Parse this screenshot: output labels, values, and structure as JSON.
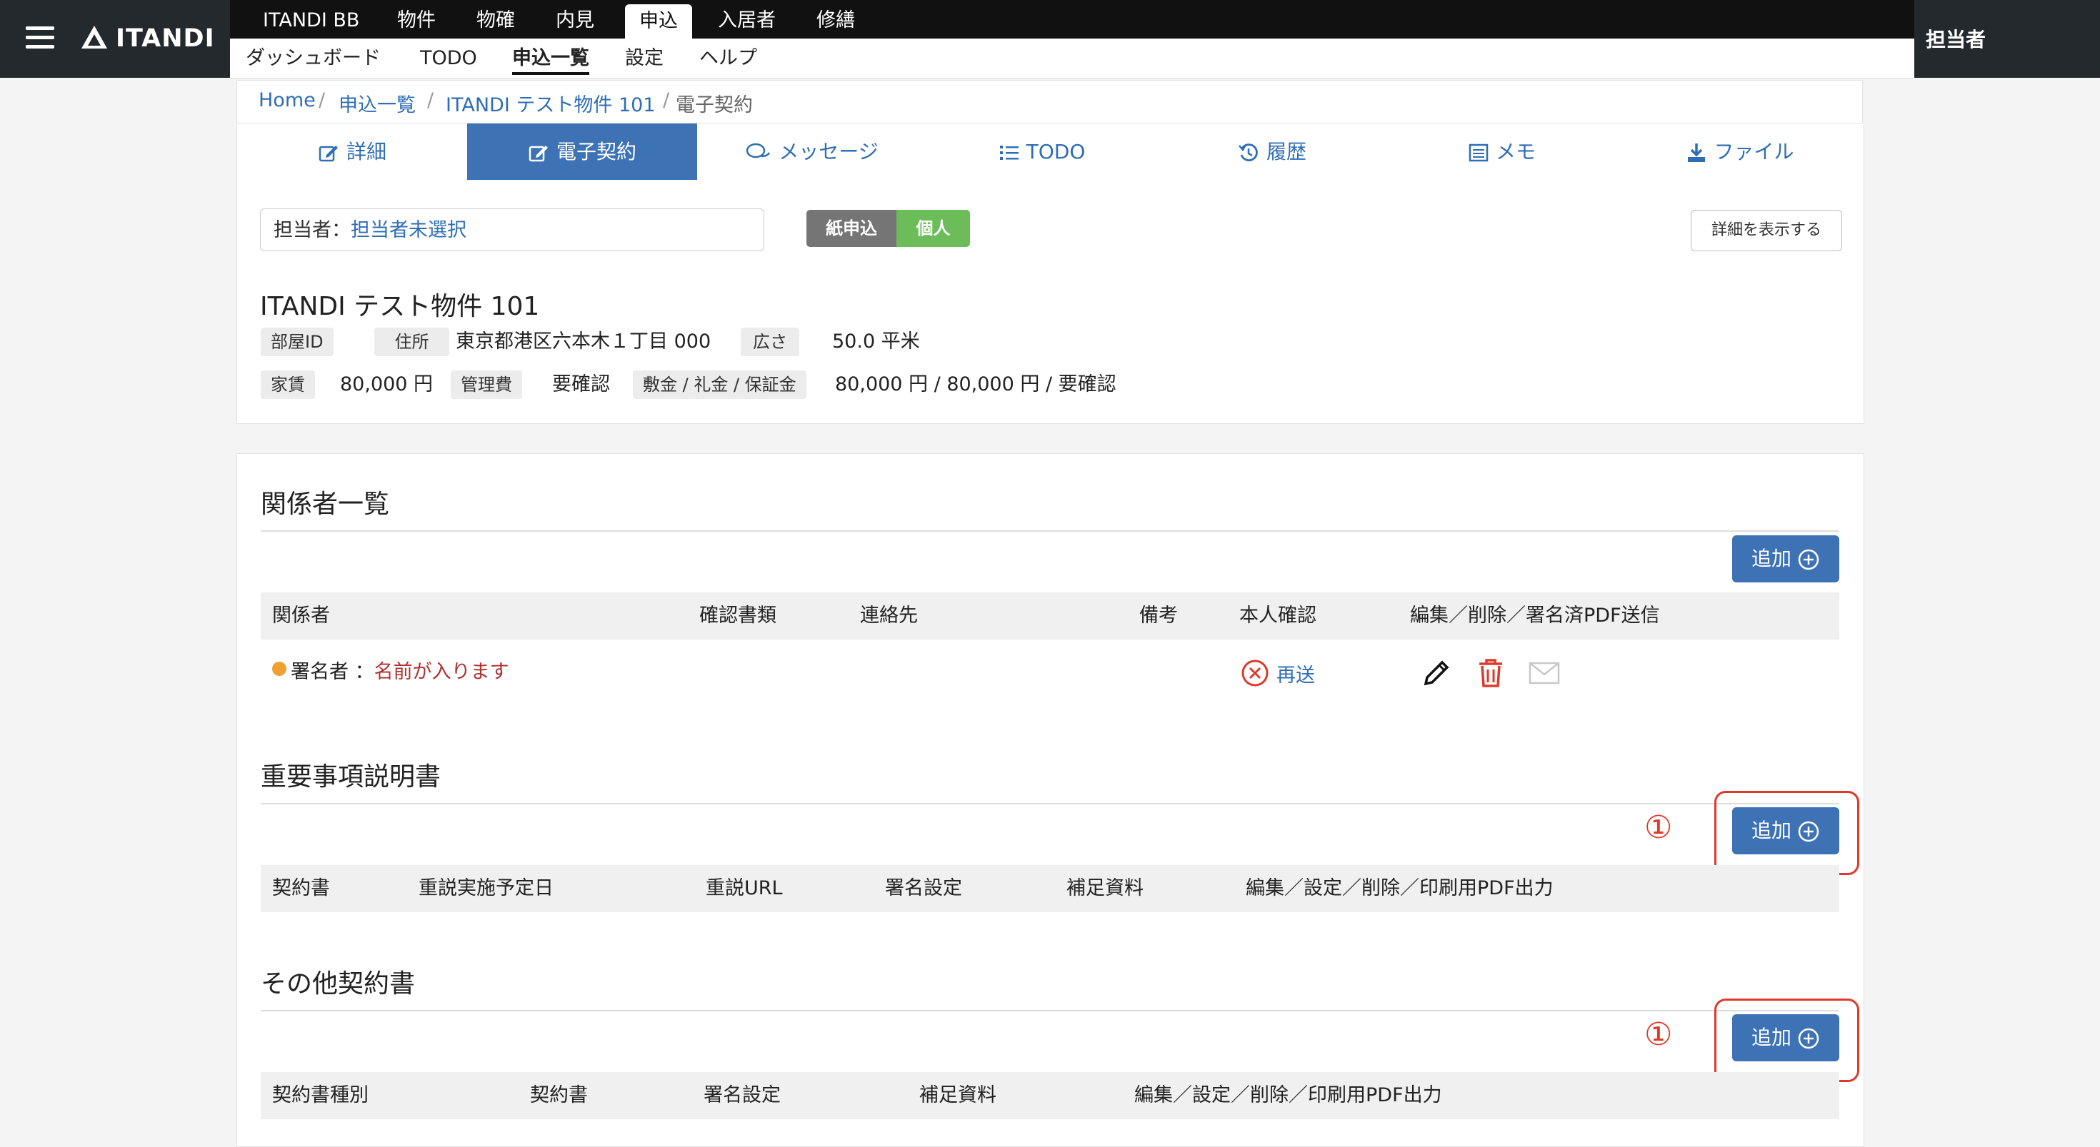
{
  "header": {
    "brand": "ITANDI",
    "top_nav": [
      "ITANDI BB",
      "物件",
      "物確",
      "内見",
      "申込",
      "入居者",
      "修繕"
    ],
    "active_top": "申込",
    "sub_nav": [
      "ダッシュボード",
      "TODO",
      "申込一覧",
      "設定",
      "ヘルプ"
    ],
    "active_sub": "申込一覧",
    "user_label": "担当者"
  },
  "breadcrumb": [
    "Home",
    "申込一覧",
    "ITANDI テスト物件 101",
    "電子契約"
  ],
  "tabs": [
    "詳細",
    "電子契約",
    "メッセージ",
    "TODO",
    "履歴",
    "メモ",
    "ファイル"
  ],
  "active_tab": "電子契約",
  "info": {
    "assignee_label": "担当者：",
    "assignee_value": "担当者未選択",
    "badge_paper": "紙申込",
    "badge_person": "個人",
    "detail_button": "詳細を表示する",
    "property_title": "ITANDI テスト物件 101",
    "room_id_label": "部屋ID",
    "address_label": "住所",
    "address_value": "東京都港区六本木１丁目 000",
    "area_label": "広さ",
    "area_value": "50.0 平米",
    "rent_label": "家賃",
    "rent_value": "80,000 円",
    "fee_label": "管理費",
    "fee_value": "要確認",
    "deposit_label": "敷金 / 礼金 / 保証金",
    "deposit_value": "80,000 円 / 80,000 円 / 要確認"
  },
  "parties": {
    "title": "関係者一覧",
    "add_label": "追加",
    "columns": [
      "関係者",
      "確認書類",
      "連絡先",
      "備考",
      "本人確認",
      "編集／削除／署名済PDF送信"
    ],
    "row": {
      "role": "署名者",
      "colon": "：",
      "name": "名前が入ります",
      "resend": "再送"
    }
  },
  "important": {
    "title": "重要事項説明書",
    "add_label": "追加",
    "marker": "①",
    "columns": [
      "契約書",
      "重説実施予定日",
      "重説URL",
      "署名設定",
      "補足資料",
      "編集／設定／削除／印刷用PDF出力"
    ]
  },
  "other": {
    "title": "その他契約書",
    "add_label": "追加",
    "marker": "①",
    "columns": [
      "契約書種別",
      "契約書",
      "署名設定",
      "補足資料",
      "編集／設定／削除／印刷用PDF出力"
    ]
  },
  "colors": {
    "accent": "#3d72b4",
    "link": "#2f6eb5",
    "badge_gray": "#757575",
    "badge_green": "#6cbd5a",
    "alert_red": "#e0392b",
    "status_orange": "#f0a030"
  }
}
